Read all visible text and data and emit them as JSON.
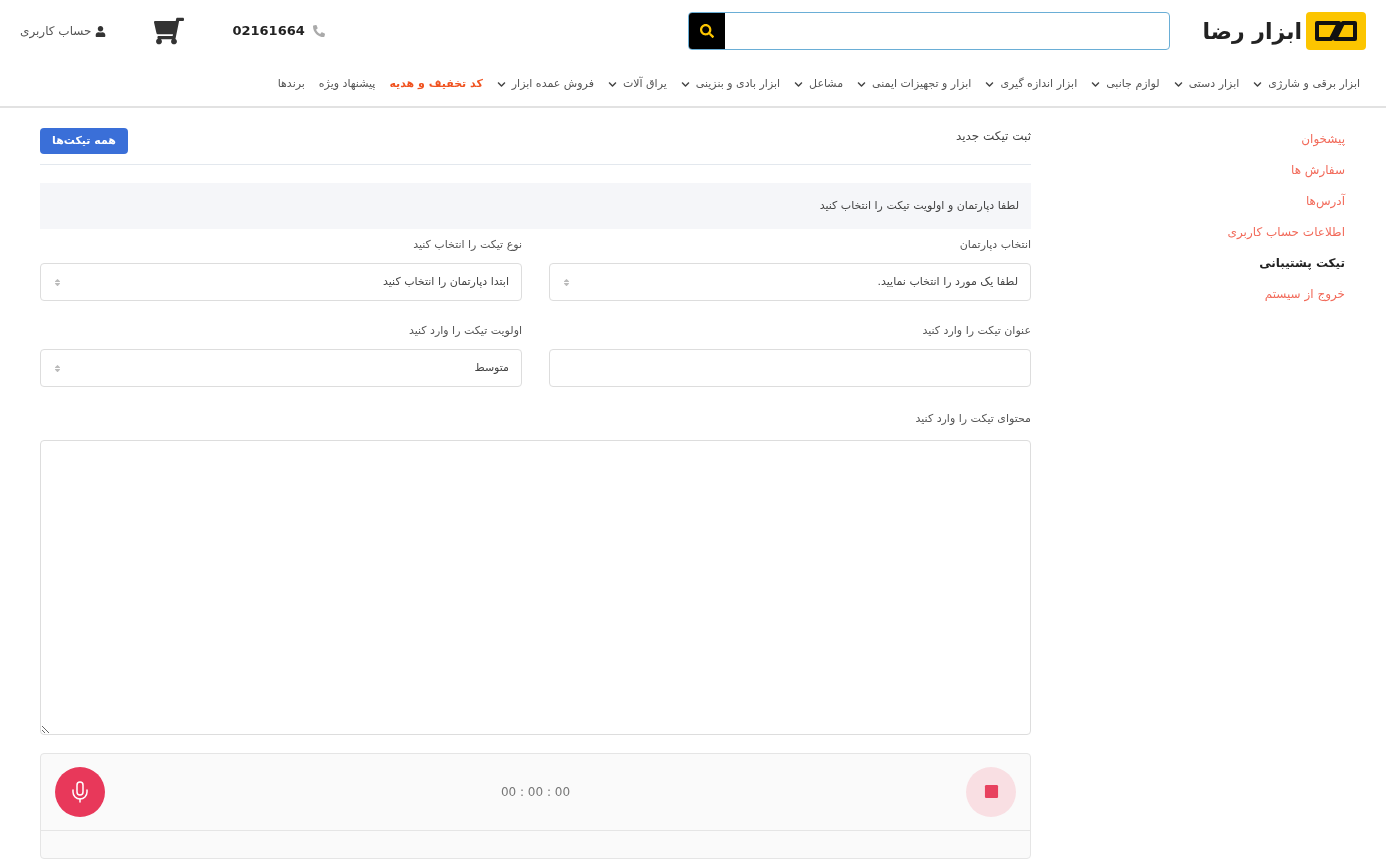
{
  "header": {
    "logo_text": "ابزار رضا",
    "phone": "02161664",
    "account": "حساب کاربری"
  },
  "nav": [
    {
      "label": "ابزار برقی و شارژی",
      "kind": "menu"
    },
    {
      "label": "ابزار دستی",
      "kind": "menu"
    },
    {
      "label": "لوازم جانبی",
      "kind": "menu"
    },
    {
      "label": "ابزار اندازه گیری",
      "kind": "menu"
    },
    {
      "label": "ابزار و تجهیزات ایمنی",
      "kind": "menu"
    },
    {
      "label": "مشاعل",
      "kind": "menu"
    },
    {
      "label": "ابزار بادی و بنزینی",
      "kind": "menu"
    },
    {
      "label": "یراق آلات",
      "kind": "menu"
    },
    {
      "label": "فروش عمده ابزار",
      "kind": "menu"
    },
    {
      "label": "کد تخفیف و هدیه",
      "kind": "promo"
    },
    {
      "label": "پیشنهاد ویژه",
      "kind": "link"
    },
    {
      "label": "برندها",
      "kind": "link"
    }
  ],
  "sidebar": {
    "items": [
      {
        "label": "پیشخوان",
        "selected": false
      },
      {
        "label": "سفارش ها",
        "selected": false
      },
      {
        "label": "آدرس‌ها",
        "selected": false
      },
      {
        "label": "اطلاعات حساب کاربری",
        "selected": false
      },
      {
        "label": "تیکت پشتیبانی",
        "selected": true
      },
      {
        "label": "خروج از سیستم",
        "selected": false
      }
    ]
  },
  "ticket_form": {
    "title": "ثبت تیکت جدید",
    "all_tickets_button": "همه تیکت‌ها",
    "notice": "لطفا دپارتمان و اولویت تیکت را انتخاب کنید",
    "fields": [
      {
        "label": "انتخاب دپارتمان",
        "kind": "select",
        "value": "لطفا یک مورد را انتخاب نمایید."
      },
      {
        "label": "نوع تیکت را انتخاب کنید",
        "kind": "select",
        "value": "ابتدا دپارتمان را انتخاب کنید"
      },
      {
        "label": "عنوان تیکت را وارد کنید",
        "kind": "text"
      },
      {
        "label": "اولویت تیکت را وارد کنید",
        "kind": "select",
        "value": "متوسط"
      }
    ],
    "content_label": "محتوای تیکت را وارد کنید",
    "recorder": {
      "timer": "00 : 00 : 00"
    }
  }
}
